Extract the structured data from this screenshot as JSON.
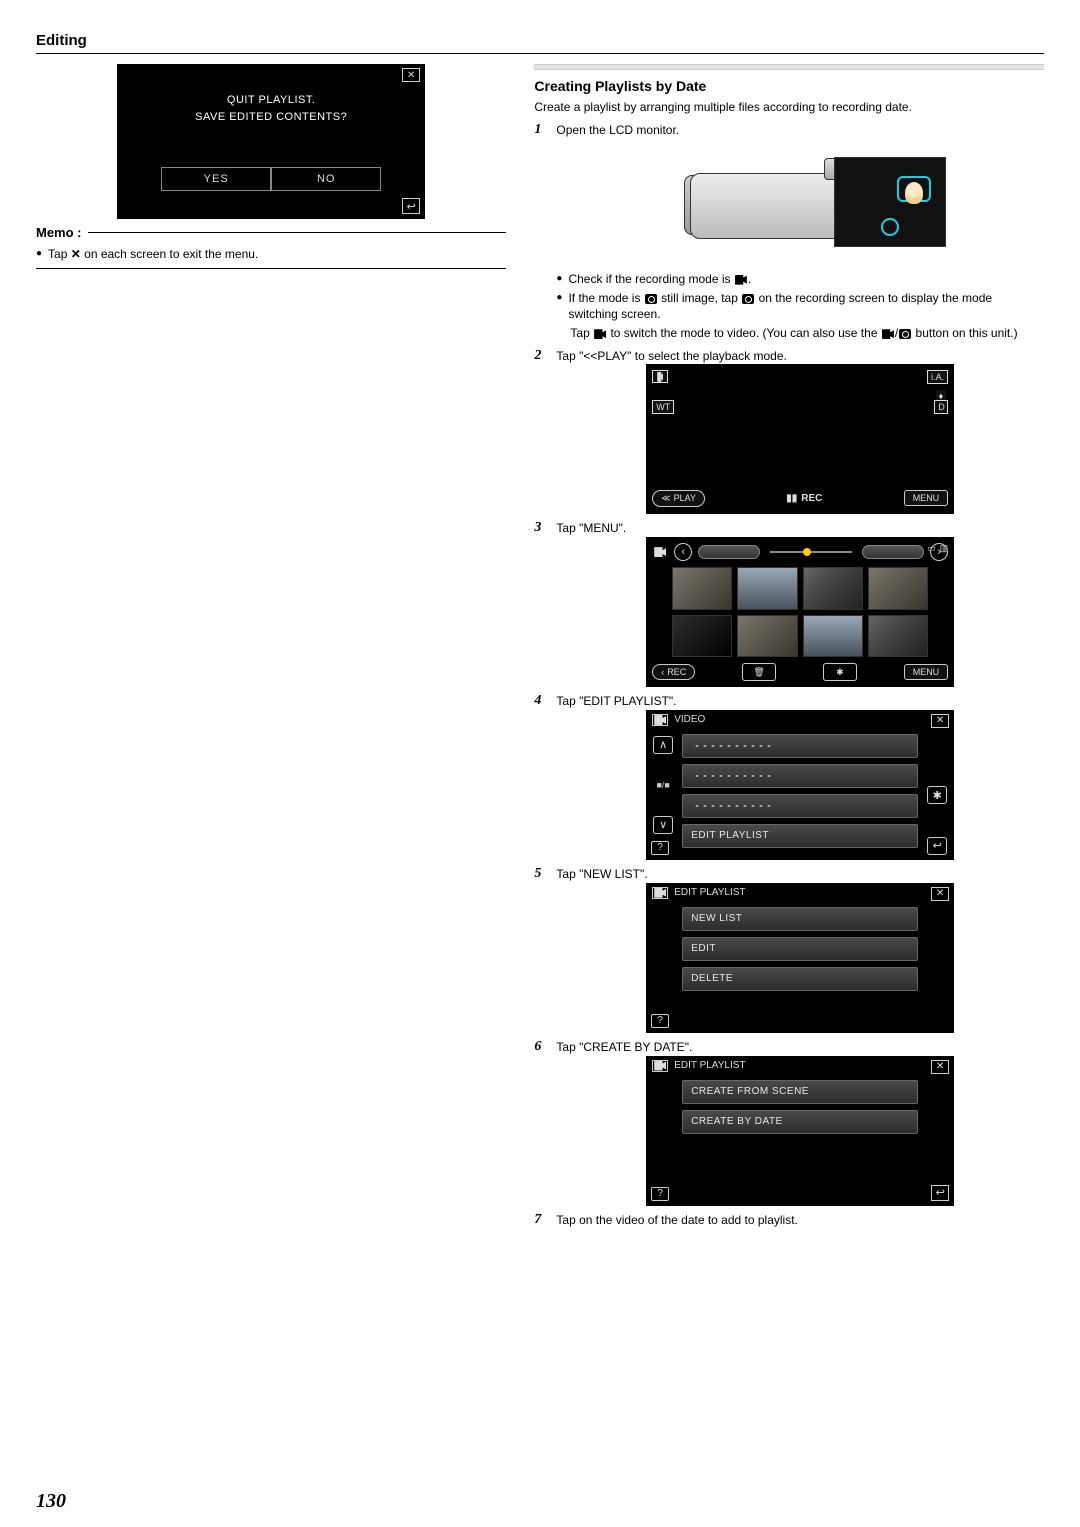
{
  "page_number": "130",
  "header": {
    "title": "Editing"
  },
  "left": {
    "quit_screen": {
      "line1": "QUIT PLAYLIST.",
      "line2": "SAVE EDITED CONTENTS?",
      "yes": "YES",
      "no": "NO"
    },
    "memo_label": "Memo :",
    "memo_bullet_pre": "Tap",
    "memo_bullet_post": "on each screen to exit the menu."
  },
  "right": {
    "subheading": "Creating Playlists by Date",
    "intro": "Create a playlist by arranging multiple files according to recording date.",
    "step1": {
      "text": "Open the LCD monitor.",
      "check_pre": "Check if the recording mode is",
      "check_post": ".",
      "mode_a": "If the mode is",
      "mode_b": "still image, tap",
      "mode_c": "on the recording screen to display the mode switching screen.",
      "tap_a": "Tap",
      "tap_b": "to switch the mode to video. (You can also use the",
      "tap_c": "button on this unit.)"
    },
    "step2": {
      "text": "Tap \"<<PLAY\" to select the playback mode.",
      "labels": {
        "ia": "i.A.",
        "wt": "WT",
        "d": "D",
        "play": "PLAY",
        "rec": "REC",
        "menu": "MENU"
      }
    },
    "step3": {
      "text": "Tap \"MENU\".",
      "labels": {
        "rec": "REC",
        "menu": "MENU",
        "sd": "SD"
      }
    },
    "step4": {
      "text": "Tap \"EDIT PLAYLIST\".",
      "title": "VIDEO",
      "item_edit": "EDIT PLAYLIST",
      "counter": "■/■"
    },
    "step5": {
      "text": "Tap \"NEW LIST\".",
      "title": "EDIT PLAYLIST",
      "items": {
        "new": "NEW LIST",
        "edit": "EDIT",
        "delete": "DELETE"
      }
    },
    "step6": {
      "text": "Tap \"CREATE BY DATE\".",
      "title": "EDIT PLAYLIST",
      "items": {
        "scene": "CREATE FROM SCENE",
        "date": "CREATE BY DATE"
      }
    },
    "step7": {
      "text": "Tap on the video of the date to add to playlist."
    }
  }
}
